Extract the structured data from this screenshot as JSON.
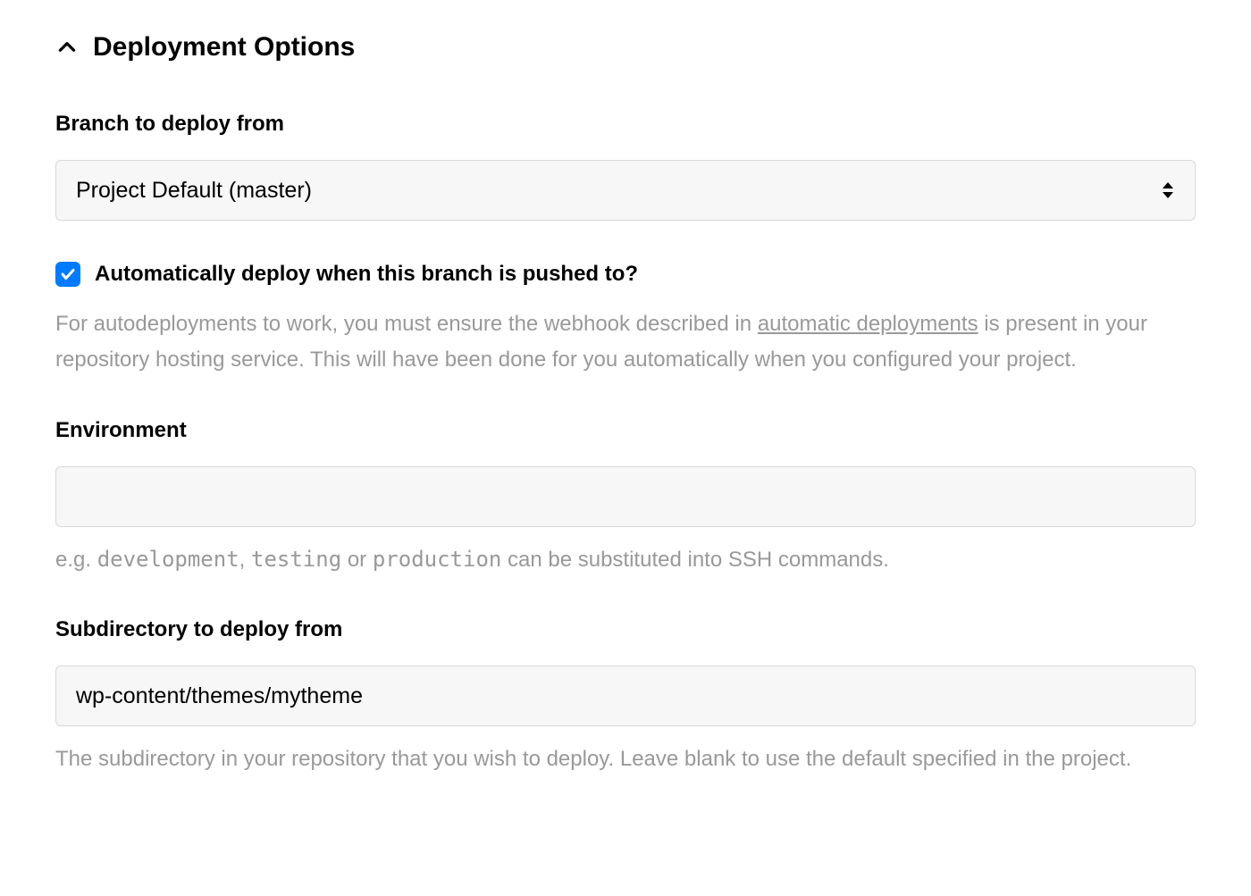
{
  "section": {
    "title": "Deployment Options"
  },
  "branch": {
    "label": "Branch to deploy from",
    "selected": "Project Default (master)"
  },
  "autodeploy": {
    "checked": true,
    "label": "Automatically deploy when this branch is pushed to?",
    "help_pre": "For autodeployments to work, you must ensure the webhook described in ",
    "help_link": "automatic deployments",
    "help_post": " is present in your repository hosting service. This will have been done for you automatically when you configured your project."
  },
  "environment": {
    "label": "Environment",
    "value": "",
    "hint_pre": "e.g. ",
    "hint_code1": "development",
    "hint_sep1": ", ",
    "hint_code2": "testing",
    "hint_sep2": " or ",
    "hint_code3": "production",
    "hint_post": " can be substituted into SSH commands."
  },
  "subdir": {
    "label": "Subdirectory to deploy from",
    "value": "wp-content/themes/mytheme",
    "hint": "The subdirectory in your repository that you wish to deploy. Leave blank to use the default specified in the project."
  }
}
